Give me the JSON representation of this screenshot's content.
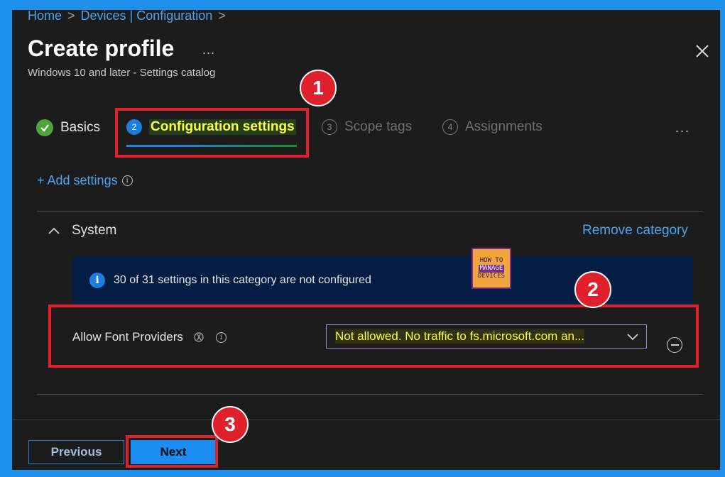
{
  "breadcrumb": {
    "items": [
      "Home",
      "Devices | Configuration"
    ],
    "separator": ">"
  },
  "header": {
    "title": "Create profile",
    "more": "...",
    "subtitle": "Windows 10 and later - Settings catalog"
  },
  "tabs": [
    {
      "label": "Basics",
      "state": "completed"
    },
    {
      "label": "Configuration settings",
      "number": "2",
      "state": "active"
    },
    {
      "label": "Scope tags",
      "number": "3",
      "state": "pending"
    },
    {
      "label": "Assignments",
      "number": "4",
      "state": "pending"
    }
  ],
  "tabs_more": "...",
  "add_settings": {
    "label": "+ Add settings"
  },
  "category": {
    "name": "System",
    "remove_label": "Remove category",
    "banner": "30 of 31 settings in this category are not configured"
  },
  "setting": {
    "label": "Allow Font Providers",
    "value": "Not allowed. No traffic to fs.microsoft.com an..."
  },
  "footer": {
    "previous_label": "Previous",
    "next_label": "Next"
  },
  "callouts": [
    "1",
    "2",
    "3"
  ],
  "watermark": {
    "lines": [
      "HOW TO",
      "MANAGE",
      "DEVICES"
    ]
  },
  "colors": {
    "accent": "#4aa4ee",
    "callout": "#e0202a",
    "highlight": "#ffff3a",
    "banner": "#041d45",
    "primary_button": "#1b8cf0"
  },
  "icons": [
    "check-icon",
    "close-icon",
    "info-icon",
    "chevron-up-icon",
    "chevron-down-icon",
    "minus-circle-icon",
    "policy-icon"
  ]
}
